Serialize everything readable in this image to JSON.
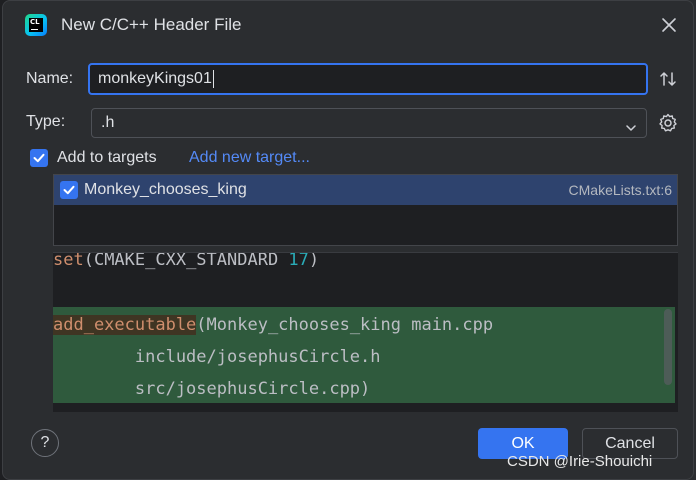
{
  "dialog": {
    "title": "New C/C++ Header File",
    "logo_text": "CL",
    "logo_icon": "clion-logo-icon"
  },
  "form": {
    "name_label": "Name:",
    "name_value": "monkeyKings01",
    "type_label": "Type:",
    "type_value": ".h",
    "add_targets_checked": true,
    "add_targets_label": "Add to targets",
    "add_new_target_link": "Add new target..."
  },
  "targets": [
    {
      "checked": true,
      "name": "Monkey_chooses_king",
      "file": "CMakeLists.txt:6"
    }
  ],
  "code_preview": {
    "line1": {
      "kw": "set",
      "rest": "(CMAKE_CXX_STANDARD ",
      "num": "17",
      "end": ")"
    },
    "line2": {
      "kw": "add_executable",
      "rest": "(Monkey_chooses_king main.cpp"
    },
    "line3": "        include/josephusCircle.h",
    "line4": "        src/josephusCircle.cpp)"
  },
  "buttons": {
    "help": "?",
    "ok": "OK",
    "cancel": "Cancel"
  },
  "watermark": "CSDN @Irie-Shouichi",
  "colors": {
    "accent": "#3574f0",
    "link": "#548af7",
    "highlight_green": "#2f5a3d",
    "selection": "#2e436e"
  }
}
